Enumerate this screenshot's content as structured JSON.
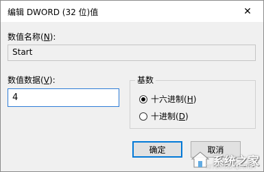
{
  "window": {
    "title": "编辑 DWORD (32 位)值",
    "close_symbol": "✕"
  },
  "value_name": {
    "label_prefix": "数值名称(",
    "label_key": "N",
    "label_suffix": "):",
    "value": "Start"
  },
  "value_data": {
    "label_prefix": "数值数据(",
    "label_key": "V",
    "label_suffix": "):",
    "value": "4"
  },
  "base": {
    "legend": "基数",
    "options": [
      {
        "prefix": "十六进制(",
        "key": "H",
        "suffix": ")",
        "checked": true
      },
      {
        "prefix": "十进制(",
        "key": "D",
        "suffix": ")",
        "checked": false
      }
    ]
  },
  "buttons": {
    "ok_label": "确定",
    "cancel_label": "取消"
  },
  "watermark": {
    "text": "系统之家",
    "url": "XITONGZHIJIA.NET"
  }
}
